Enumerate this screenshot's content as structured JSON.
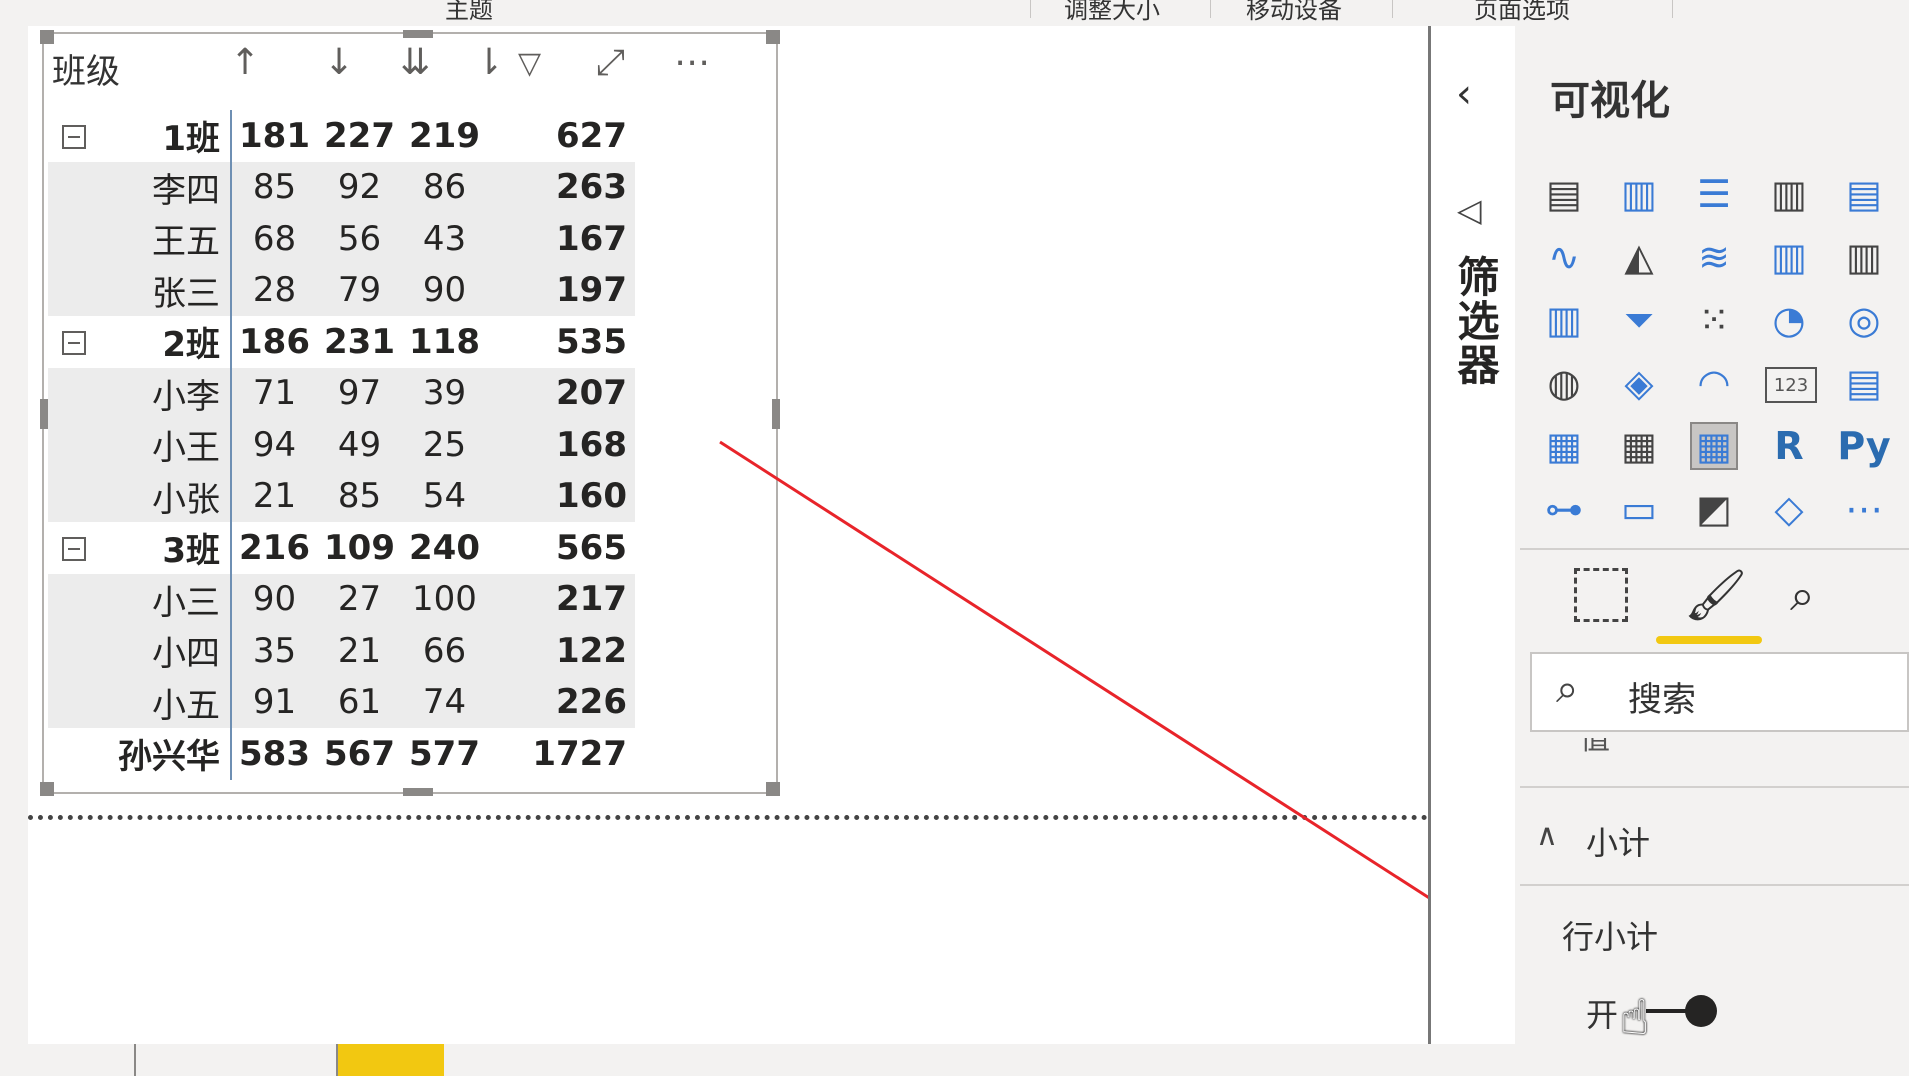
{
  "ribbon": {
    "items": [
      "主题",
      "调整大小",
      "移动设备",
      "页面选项"
    ]
  },
  "visual": {
    "header": {
      "title": "班级",
      "icons": [
        "drill-up-icon",
        "drill-down-icon",
        "expand-all-icon",
        "expand-next-icon",
        "filter-icon",
        "focus-mode-icon",
        "more-options-icon"
      ]
    },
    "rows": [
      {
        "type": "group",
        "name": "1班",
        "v1": "181",
        "v2": "227",
        "v3": "219",
        "total": "627"
      },
      {
        "type": "leaf",
        "name": "李四",
        "v1": "85",
        "v2": "92",
        "v3": "86",
        "total": "263"
      },
      {
        "type": "leaf",
        "name": "王五",
        "v1": "68",
        "v2": "56",
        "v3": "43",
        "total": "167"
      },
      {
        "type": "leaf",
        "name": "张三",
        "v1": "28",
        "v2": "79",
        "v3": "90",
        "total": "197"
      },
      {
        "type": "group",
        "name": "2班",
        "v1": "186",
        "v2": "231",
        "v3": "118",
        "total": "535"
      },
      {
        "type": "leaf",
        "name": "小李",
        "v1": "71",
        "v2": "97",
        "v3": "39",
        "total": "207"
      },
      {
        "type": "leaf",
        "name": "小王",
        "v1": "94",
        "v2": "49",
        "v3": "25",
        "total": "168"
      },
      {
        "type": "leaf",
        "name": "小张",
        "v1": "21",
        "v2": "85",
        "v3": "54",
        "total": "160"
      },
      {
        "type": "group",
        "name": "3班",
        "v1": "216",
        "v2": "109",
        "v3": "240",
        "total": "565"
      },
      {
        "type": "leaf",
        "name": "小三",
        "v1": "90",
        "v2": "27",
        "v3": "100",
        "total": "217"
      },
      {
        "type": "leaf",
        "name": "小四",
        "v1": "35",
        "v2": "21",
        "v3": "66",
        "total": "122"
      },
      {
        "type": "leaf",
        "name": "小五",
        "v1": "91",
        "v2": "61",
        "v3": "74",
        "total": "226"
      },
      {
        "type": "total",
        "name": "孙兴华",
        "v1": "583",
        "v2": "567",
        "v3": "577",
        "total": "1727"
      }
    ]
  },
  "filters_pane": {
    "label": "筛选器"
  },
  "visualizations": {
    "title": "可视化",
    "icons": [
      "stacked-bar-icon",
      "stacked-column-icon",
      "clustered-bar-icon",
      "clustered-column-icon",
      "100-bar-icon",
      "line-chart-icon",
      "area-chart-icon",
      "stacked-area-icon",
      "line-column-icon",
      "line-stacked-column-icon",
      "ribbon-chart-icon",
      "funnel-icon",
      "scatter-icon",
      "pie-chart-icon",
      "donut-icon",
      "map-icon",
      "filled-map-icon",
      "gauge-icon",
      "card-icon",
      "multi-row-card-icon",
      "slicer-icon",
      "table-icon",
      "matrix-icon",
      "r-visual-icon",
      "python-visual-icon",
      "decomposition-tree-icon",
      "qa-icon",
      "shape-map-icon",
      "key-influencers-icon",
      "more-visuals-icon"
    ],
    "r_label": "R",
    "py_label": "Py",
    "card_label": "123",
    "tabs": [
      "fields-icon",
      "format-icon",
      "analytics-icon"
    ],
    "search_placeholder": "搜索",
    "partial_section": "值",
    "section": "小计",
    "setting_label": "行小计",
    "toggle_label": "开"
  },
  "annotation": {
    "arrow_color": "#e8242a"
  }
}
